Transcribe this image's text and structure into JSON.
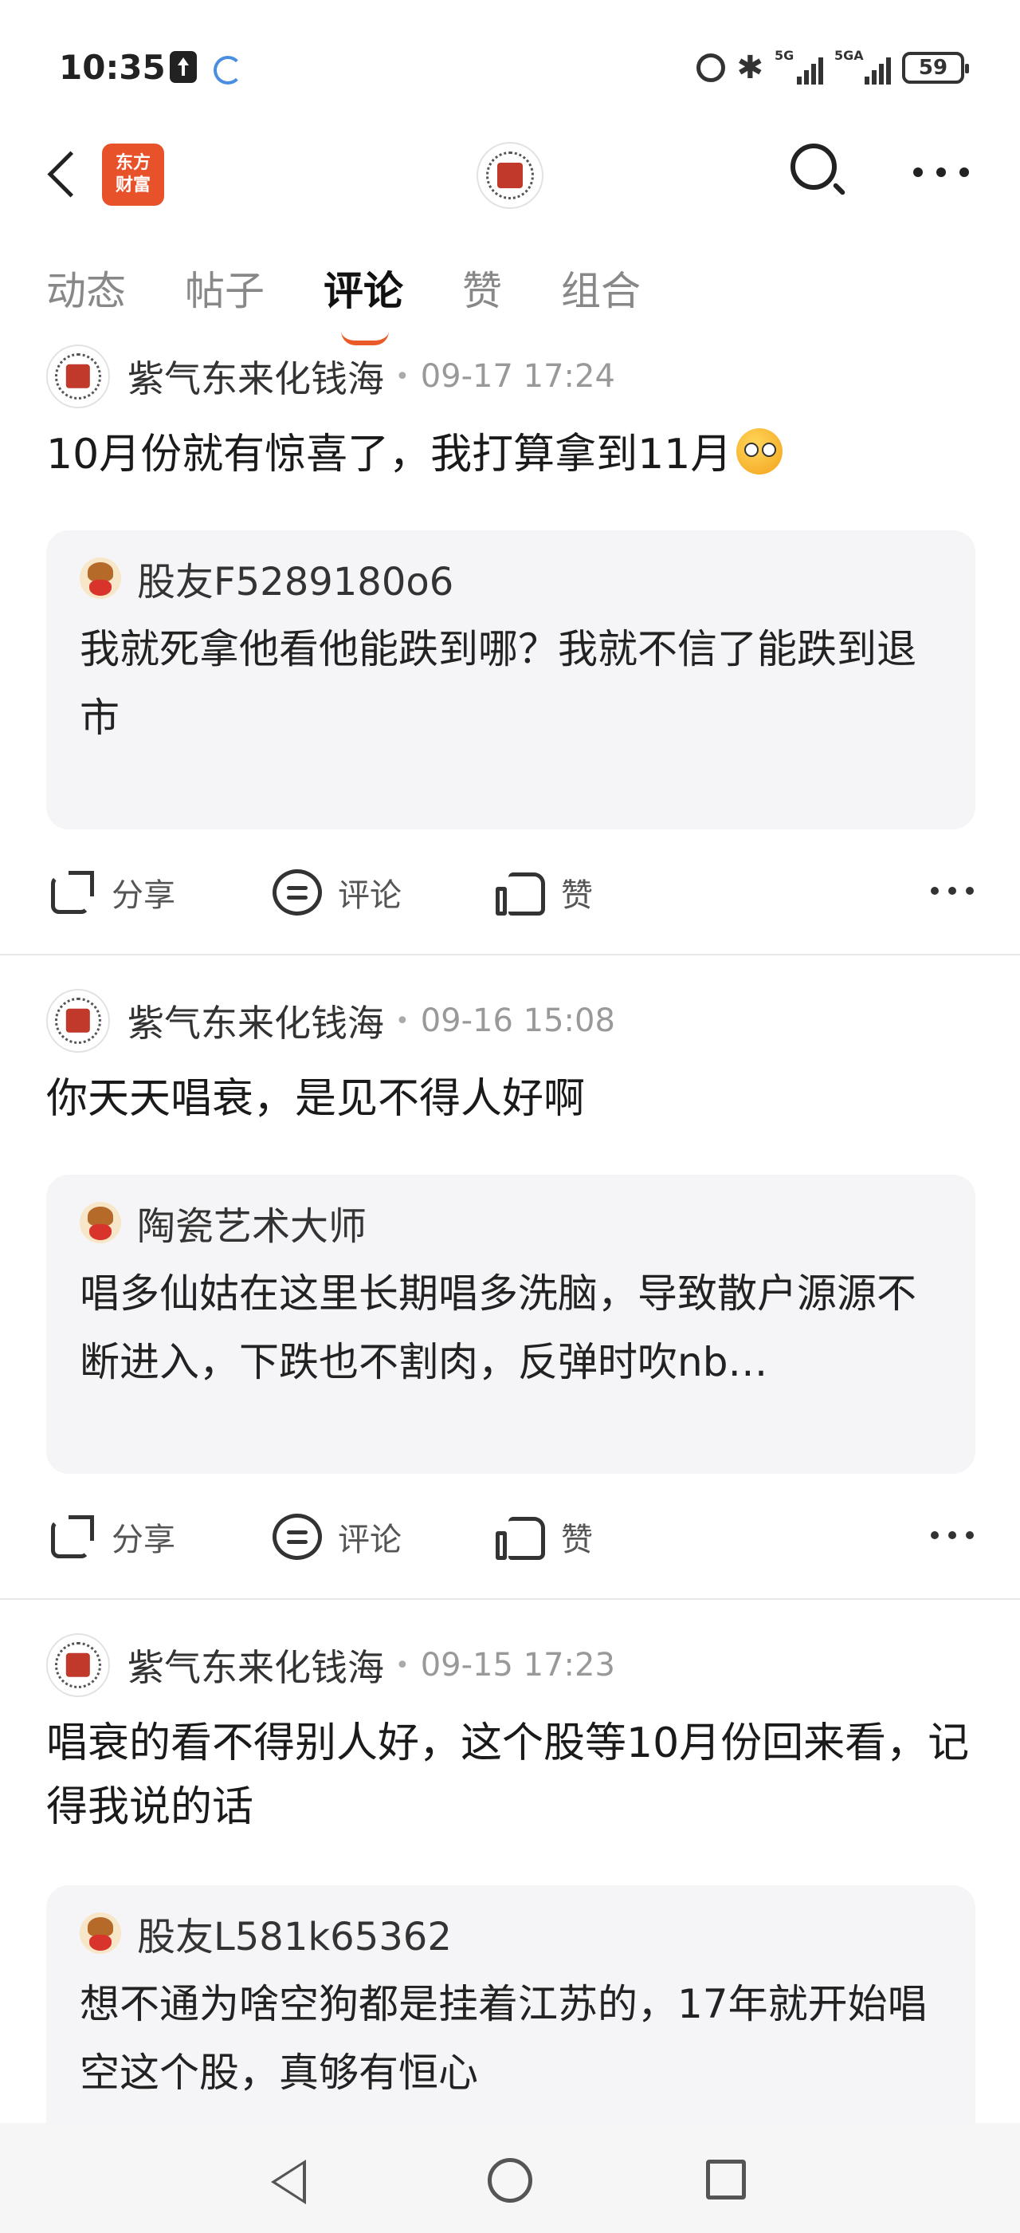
{
  "status_bar": {
    "time": "10:35",
    "signal_1_label": "5G",
    "signal_2_label": "5GA",
    "battery": "59"
  },
  "header": {
    "app_logo_text": "东方\n财富"
  },
  "tabs": [
    {
      "label": "动态"
    },
    {
      "label": "帖子"
    },
    {
      "label": "评论"
    },
    {
      "label": "赞"
    },
    {
      "label": "组合"
    }
  ],
  "active_tab": "评论",
  "posts": [
    {
      "author": "紫气东来化钱海",
      "time": "09-17 17:24",
      "content": "10月份就有惊喜了，我打算拿到11月",
      "quote": {
        "user": "股友F5289180o6",
        "text": "我就死拿他看他能跌到哪？我就不信了能跌到退市"
      }
    },
    {
      "author": "紫气东来化钱海",
      "time": "09-16 15:08",
      "content": "你天天唱衰，是见不得人好啊",
      "quote": {
        "user": "陶瓷艺术大师",
        "text": "唱多仙姑在这里长期唱多洗脑，导致散户源源不断进入，下跌也不割肉，反弹时吹nb…"
      }
    },
    {
      "author": "紫气东来化钱海",
      "time": "09-15 17:23",
      "content": "唱衰的看不得别人好，这个股等10月份回来看，记得我说的话",
      "quote": {
        "user": "股友L581k65362",
        "text": "想不通为啥空狗都是挂着江苏的，17年就开始唱空这个股，真够有恒心"
      }
    }
  ],
  "actions": {
    "share": "分享",
    "comment": "评论",
    "like": "赞"
  }
}
